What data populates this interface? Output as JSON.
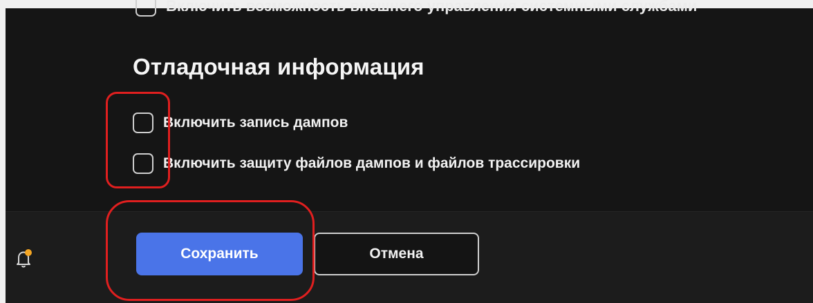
{
  "settings": {
    "external_control_label": "Включить возможность внешнего управления системными службами",
    "debug_section_title": "Отладочная информация",
    "dump_write_label": "Включить запись дампов",
    "dump_protect_label": "Включить защиту файлов дампов и файлов трассировки"
  },
  "footer": {
    "save_label": "Сохранить",
    "cancel_label": "Отмена"
  },
  "colors": {
    "accent": "#4a74e8",
    "annotation": "#e01f1f",
    "notification_dot": "#f5a623"
  },
  "icons": {
    "bell": "bell-icon"
  }
}
